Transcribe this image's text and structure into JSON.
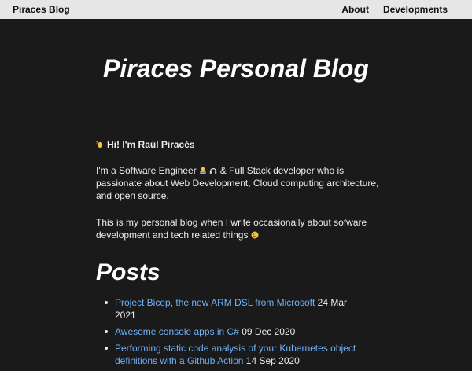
{
  "navbar": {
    "brand": "Piraces Blog",
    "links": [
      {
        "label": "About"
      },
      {
        "label": "Developments"
      }
    ]
  },
  "hero": {
    "title": "Piraces Personal Blog"
  },
  "intro": {
    "greeting": "Hi! I'm Raúl Piracés",
    "greeting_icon": "waving-hand-icon",
    "para1_a": "I'm a Software Engineer",
    "para1_icons": [
      "technologist-icon",
      "headphones-icon"
    ],
    "para1_b": "& Full Stack developer who is passionate about Web Development, Cloud computing architecture, and open source.",
    "para2": "This is my personal blog when I write occasionally about sofware development and tech related things",
    "para2_icon": "smiling-face-icon"
  },
  "posts": {
    "title": "Posts",
    "items": [
      {
        "title": "Project Bicep, the new ARM DSL from Microsoft",
        "date": "24 Mar 2021"
      },
      {
        "title": "Awesome console apps in C#",
        "date": "09 Dec 2020"
      },
      {
        "title": "Performing static code analysis of your Kubernetes object definitions with a Github Action",
        "date": "14 Sep 2020"
      }
    ]
  },
  "colors": {
    "background": "#1b1a1b",
    "navbar": "#e6e6e6",
    "link": "#6fb2f5"
  }
}
